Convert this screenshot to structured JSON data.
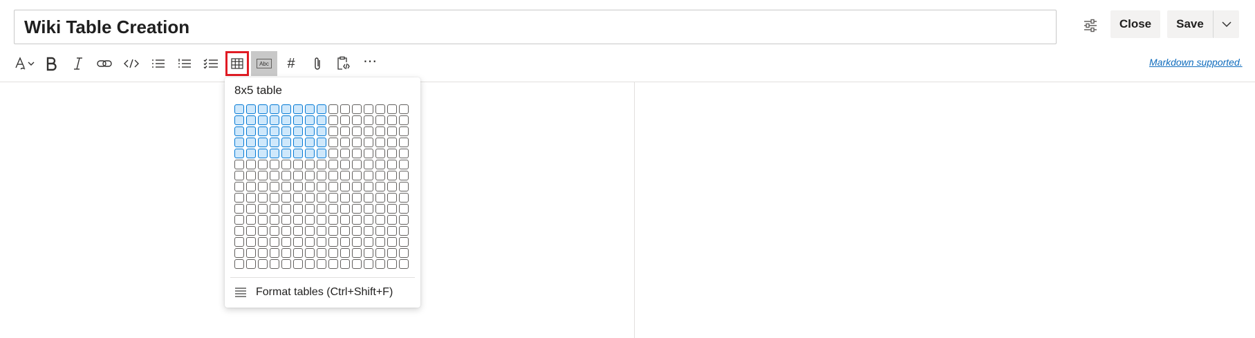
{
  "header": {
    "title": "Wiki Table Creation",
    "close_label": "Close",
    "save_label": "Save",
    "settings_icon": "sliders-icon",
    "dropdown_icon": "chevron-down-icon"
  },
  "toolbar": {
    "items": [
      {
        "name": "text-style",
        "icon": "text-highlight-icon"
      },
      {
        "name": "bold",
        "icon": "bold-icon"
      },
      {
        "name": "italic",
        "icon": "italic-icon"
      },
      {
        "name": "link",
        "icon": "link-icon"
      },
      {
        "name": "code",
        "icon": "code-icon"
      },
      {
        "name": "bulleted-list",
        "icon": "bulleted-list-icon"
      },
      {
        "name": "numbered-list",
        "icon": "numbered-list-icon"
      },
      {
        "name": "checklist",
        "icon": "checklist-icon"
      },
      {
        "name": "table",
        "icon": "table-icon",
        "active": true
      },
      {
        "name": "abc",
        "icon": "abc-icon"
      },
      {
        "name": "heading",
        "icon": "hash-icon",
        "label": "#"
      },
      {
        "name": "attachment",
        "icon": "paperclip-icon"
      },
      {
        "name": "paste-code",
        "icon": "clipboard-code-icon"
      },
      {
        "name": "more",
        "icon": "more-icon",
        "label": "⋯"
      }
    ],
    "markdown_link": "Markdown supported."
  },
  "table_popup": {
    "size_label": "8x5 table",
    "grid_columns": 15,
    "grid_rows": 15,
    "selected_columns": 8,
    "selected_rows": 5,
    "format_label": "Format tables (Ctrl+Shift+F)",
    "format_icon": "format-lines-icon"
  },
  "colors": {
    "accent": "#0078d4",
    "selected_cell": "#cfe8fb",
    "highlight_border": "#e01b24",
    "link": "#0f6cbd"
  }
}
